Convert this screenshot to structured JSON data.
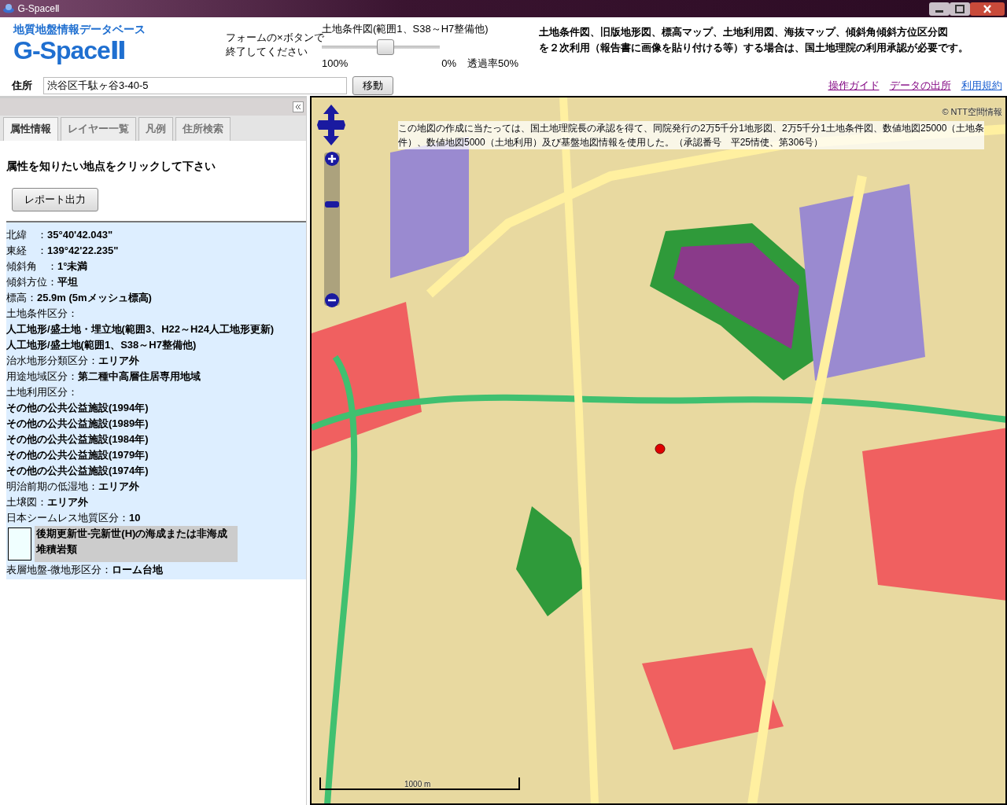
{
  "window": {
    "title": "G-SpaceⅡ"
  },
  "header": {
    "subtitle": "地質地盤情報データベース",
    "logo": "G-SpaceⅡ",
    "close_note": [
      "フォームの×ボタンで",
      "終了してください"
    ],
    "opacity": {
      "layer": "土地条件図(範囲1、S38～H7整備他)",
      "level": 0.54,
      "min_label": "100%",
      "max_label": "0%",
      "reading": "透過率50%"
    },
    "notice": [
      "土地条件図、旧版地形図、標高マップ、土地利用図、海抜マップ、傾斜角傾斜方位区分図",
      "を２次利用（報告書に画像を貼り付ける等）する場合は、国土地理院の利用承認が必要です。"
    ],
    "address": {
      "label": "住所",
      "value": "渋谷区千駄ヶ谷3-40-5",
      "button": "移動"
    },
    "links": [
      {
        "label": "操作ガイド",
        "visited": true
      },
      {
        "label": "データの出所",
        "visited": true
      },
      {
        "label": "利用規約",
        "visited": false
      }
    ]
  },
  "tabs": [
    {
      "label": "属性情報",
      "selected": true
    },
    {
      "label": "レイヤー一覧",
      "selected": false
    },
    {
      "label": "凡例",
      "selected": false
    },
    {
      "label": "住所検索",
      "selected": false
    }
  ],
  "panel": {
    "instruction": "属性を知りたい地点をクリックして下さい",
    "report_button": "レポート出力",
    "attributes": [
      {
        "kind": "pair",
        "label": "北緯　：",
        "value": "35°40'42.043\""
      },
      {
        "kind": "pair",
        "label": "東経　：",
        "value": "139°42'22.235\""
      },
      {
        "kind": "pair",
        "label": "傾斜角　：",
        "value": "1°未満"
      },
      {
        "kind": "pair",
        "label": "傾斜方位：",
        "value": "平坦"
      },
      {
        "kind": "pair",
        "label": "標高：",
        "value": "25.9m (5mメッシュ標高)"
      },
      {
        "kind": "heading",
        "label": "土地条件区分："
      },
      {
        "kind": "value",
        "value": "人工地形/盛土地・埋立地(範囲3、H22～H24人工地形更新)"
      },
      {
        "kind": "value",
        "value": "人工地形/盛土地(範囲1、S38～H7整備他)"
      },
      {
        "kind": "pair",
        "label": "治水地形分類区分：",
        "value": "エリア外"
      },
      {
        "kind": "pair",
        "label": "用途地域区分：",
        "value": "第二種中高層住居専用地域"
      },
      {
        "kind": "heading",
        "label": "土地利用区分："
      },
      {
        "kind": "value",
        "value": "その他の公共公益施設(1994年)"
      },
      {
        "kind": "value",
        "value": "その他の公共公益施設(1989年)"
      },
      {
        "kind": "value",
        "value": "その他の公共公益施設(1984年)"
      },
      {
        "kind": "value",
        "value": "その他の公共公益施設(1979年)"
      },
      {
        "kind": "value",
        "value": "その他の公共公益施設(1974年)"
      },
      {
        "kind": "pair",
        "label": "明治前期の低湿地：",
        "value": "エリア外"
      },
      {
        "kind": "pair",
        "label": "土壌図：",
        "value": "エリア外"
      },
      {
        "kind": "pair",
        "label": "日本シームレス地質区分：",
        "value": "10"
      },
      {
        "kind": "legend",
        "color": "#f0ffff",
        "value": "後期更新世-完新世(H)の海成または非海成堆積岩類"
      },
      {
        "kind": "pair",
        "label": "表層地盤-微地形区分：",
        "value": "ローム台地"
      }
    ]
  },
  "map": {
    "copyright": "© NTT空間情報",
    "credit": [
      "この地図の作成に当たっては、国土地理院長の承認を得て、同院発行の2万5千分1地形図、2万5千分1土地条件図、数値地図25000（土地条",
      "件）、数値地図5000（土地利用）及び基盤地図情報を使用した。（承認番号　平25情使、第306号）"
    ],
    "zoom": {
      "level": 0.7
    },
    "scale": "1000 m"
  }
}
